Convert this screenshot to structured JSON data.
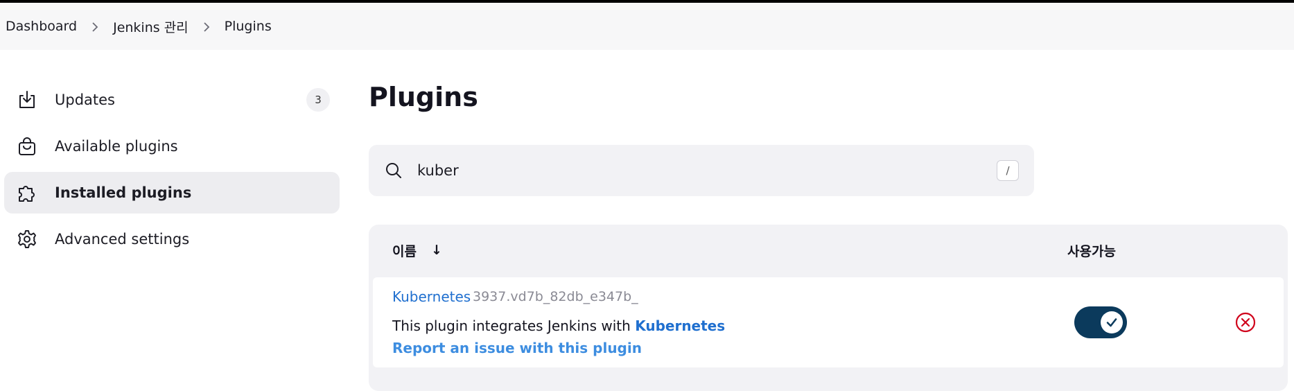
{
  "breadcrumb": {
    "items": [
      "Dashboard",
      "Jenkins 관리",
      "Plugins"
    ]
  },
  "sidebar": {
    "items": [
      {
        "label": "Updates",
        "icon": "download-icon",
        "badge": "3"
      },
      {
        "label": "Available plugins",
        "icon": "shopping-bag-icon"
      },
      {
        "label": "Installed plugins",
        "icon": "puzzle-icon",
        "active": true
      },
      {
        "label": "Advanced settings",
        "icon": "gear-icon"
      }
    ]
  },
  "main": {
    "title": "Plugins",
    "search": {
      "value": "kuber",
      "shortcut": "/"
    },
    "table": {
      "headers": {
        "name": "이름",
        "sort": "↓",
        "enabled": "사용가능"
      },
      "rows": [
        {
          "name": "Kubernetes",
          "version": "3937.vd7b_82db_e347b_",
          "description_prefix": "This plugin integrates Jenkins with ",
          "description_link": "Kubernetes",
          "report_link": "Report an issue with this plugin",
          "enabled": true
        }
      ]
    }
  },
  "colors": {
    "link": "#1f6fcf",
    "toggle_on": "#0b3a5c",
    "danger": "#d0021b"
  }
}
